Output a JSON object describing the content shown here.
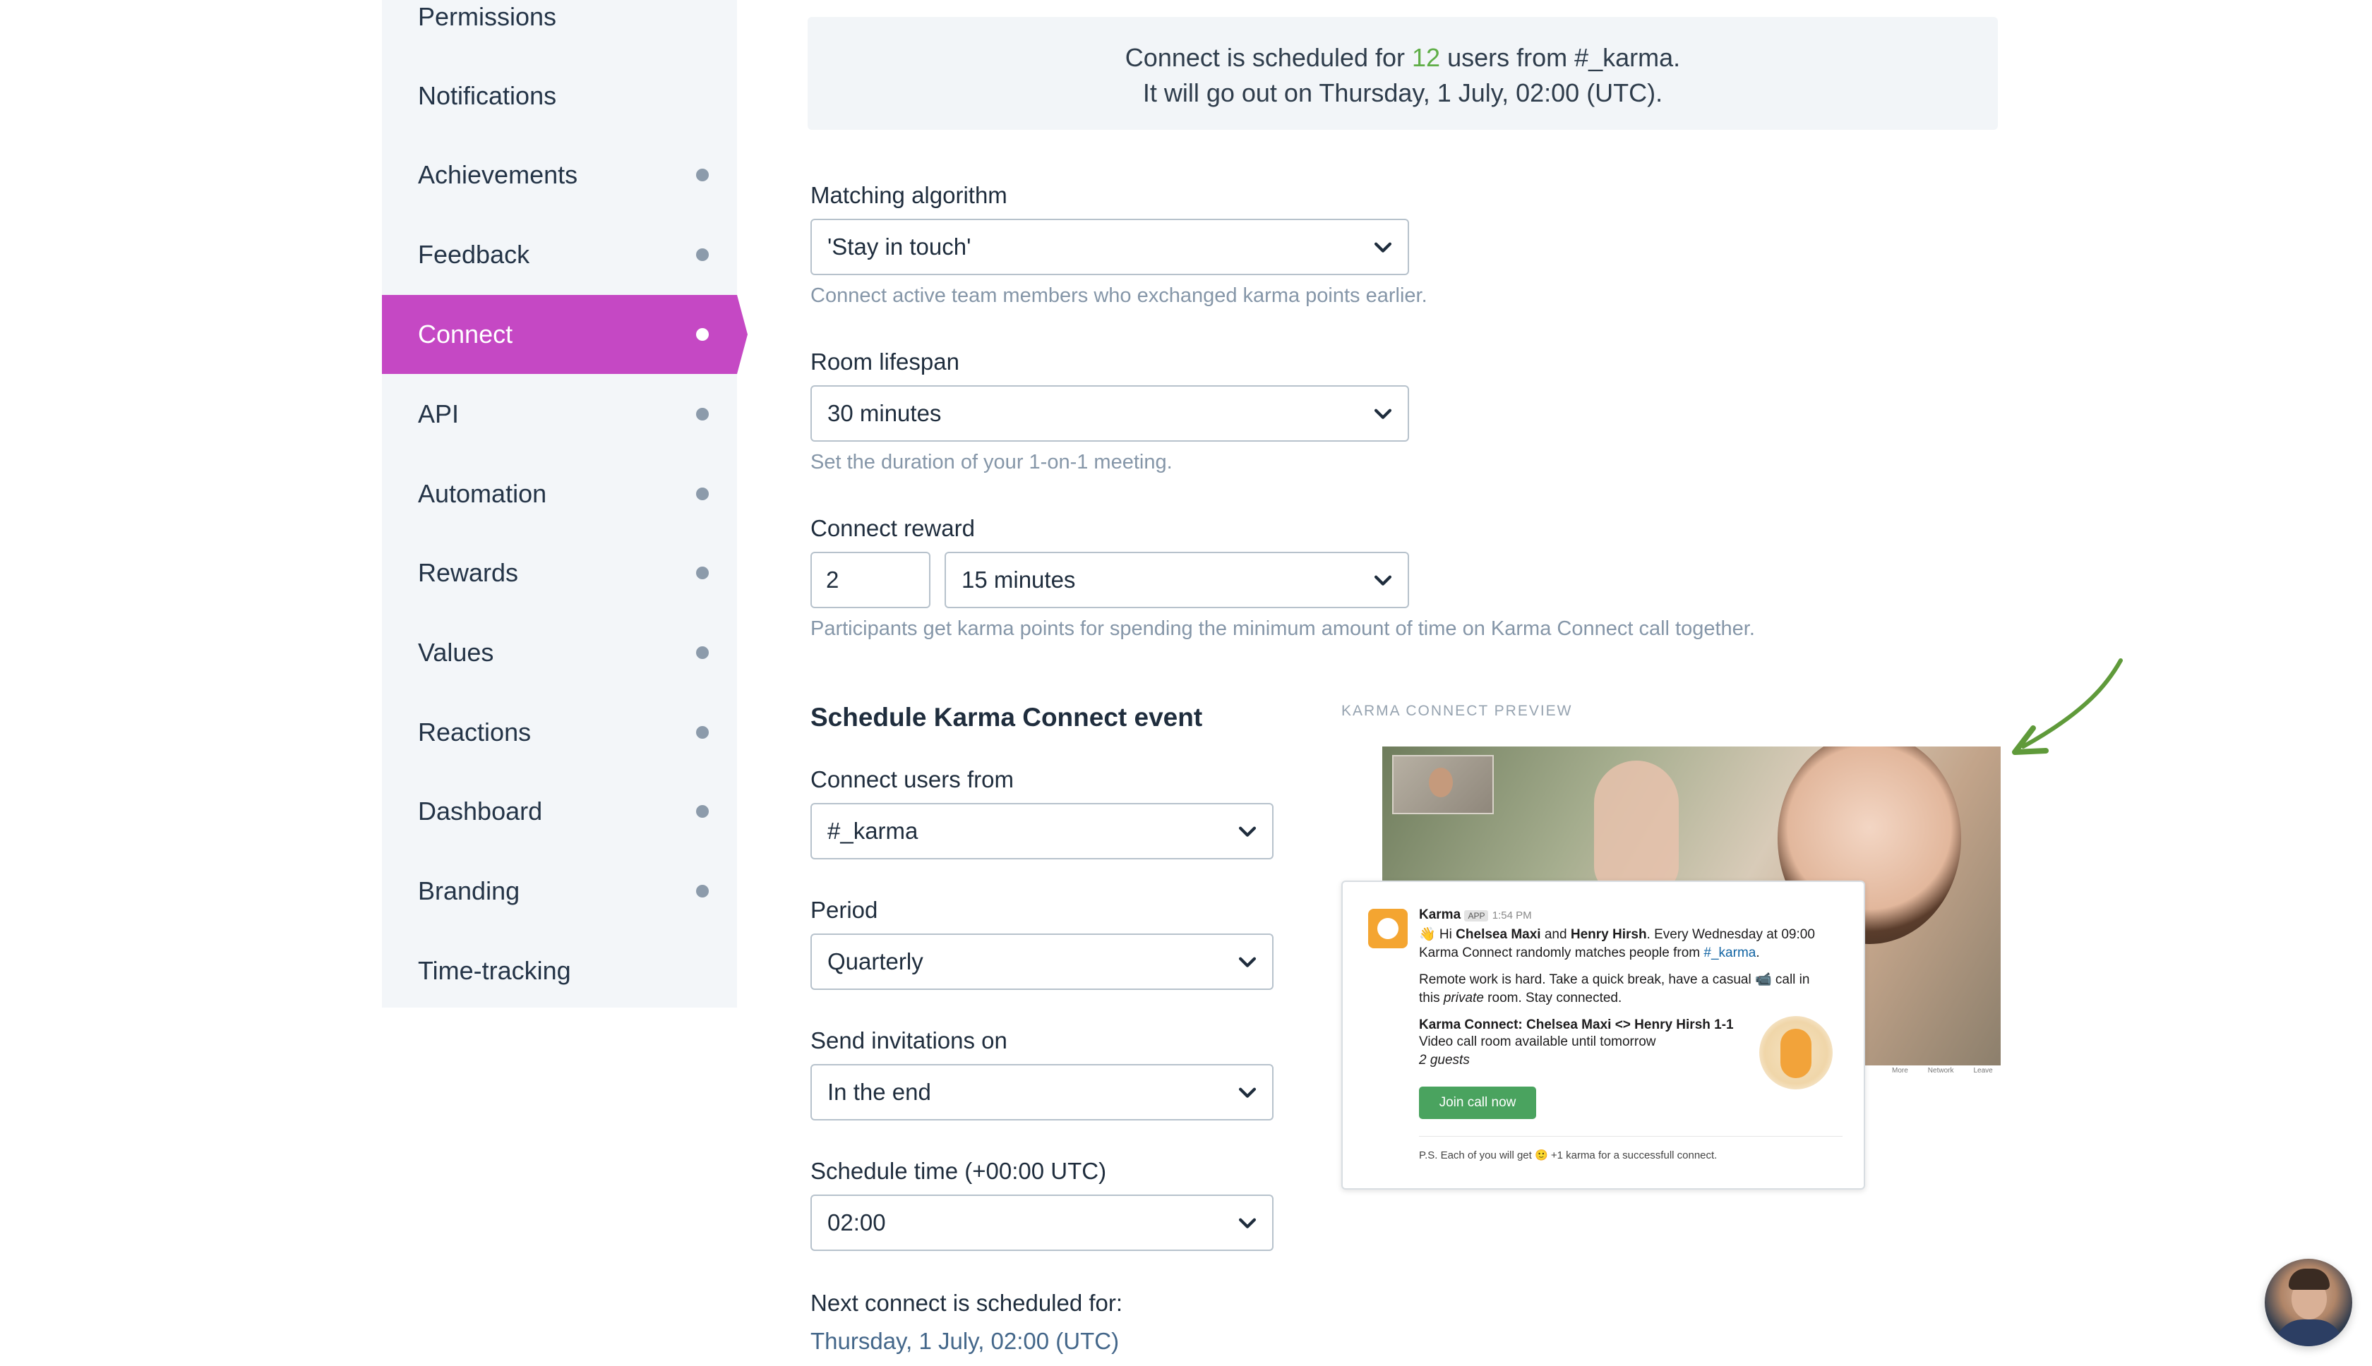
{
  "sidebar": {
    "items": [
      {
        "label": "Permissions",
        "dot": false,
        "active": false
      },
      {
        "label": "Notifications",
        "dot": false,
        "active": false
      },
      {
        "label": "Achievements",
        "dot": true,
        "active": false
      },
      {
        "label": "Feedback",
        "dot": true,
        "active": false
      },
      {
        "label": "Connect",
        "dot": true,
        "active": true
      },
      {
        "label": "API",
        "dot": true,
        "active": false
      },
      {
        "label": "Automation",
        "dot": true,
        "active": false
      },
      {
        "label": "Rewards",
        "dot": true,
        "active": false
      },
      {
        "label": "Values",
        "dot": true,
        "active": false
      },
      {
        "label": "Reactions",
        "dot": true,
        "active": false
      },
      {
        "label": "Dashboard",
        "dot": true,
        "active": false
      },
      {
        "label": "Branding",
        "dot": true,
        "active": false
      },
      {
        "label": "Time-tracking",
        "dot": false,
        "active": false
      }
    ]
  },
  "banner": {
    "pre": "Connect is scheduled for ",
    "count": "12",
    "post": " users from #_karma.",
    "line2": "It will go out on Thursday, 1 July, 02:00 (UTC)."
  },
  "matching": {
    "label": "Matching algorithm",
    "value": "'Stay in touch'",
    "help": "Connect active team members who exchanged karma points earlier."
  },
  "lifespan": {
    "label": "Room lifespan",
    "value": "30 minutes",
    "help": "Set the duration of your 1-on-1 meeting."
  },
  "reward": {
    "label": "Connect reward",
    "points": "2",
    "duration": "15 minutes",
    "help": "Participants get karma points for spending the minimum amount of time on Karma Connect call together."
  },
  "schedule": {
    "heading": "Schedule Karma Connect event",
    "users_label": "Connect users from",
    "users_value": "#_karma",
    "period_label": "Period",
    "period_value": "Quarterly",
    "invite_label": "Send invitations on",
    "invite_value": "In the end",
    "time_label": "Schedule time (+00:00 UTC)",
    "time_value": "02:00",
    "next_label": "Next connect is scheduled for:",
    "next_value": "Thursday, 1 July, 02:00 (UTC)"
  },
  "preview": {
    "label": "KARMA CONNECT PREVIEW",
    "bot_name": "Karma",
    "app_badge": "APP",
    "time": "1:54 PM",
    "line1_a": "👋 Hi ",
    "name1": "Chelsea Maxi",
    "line1_b": " and ",
    "name2": "Henry Hirsh",
    "line1_c": ". Every Wednesday at 09:00",
    "line2_a": "Karma Connect randomly matches people from ",
    "channel": "#_karma",
    "line2_b": ".",
    "line3": "Remote work is hard. Take a quick break, have a casual 📹 call in",
    "line4_a": "this ",
    "line4_em": "private",
    "line4_b": " room. Stay connected.",
    "room_title": "Karma Connect: Chelsea Maxi <> Henry Hirsh 1-1",
    "room_sub": "Video call room available until tomorrow",
    "guests": "2 guests",
    "join": "Join call now",
    "ps": "P.S. Each of you will get 🙂 +1 karma for a successfull connect.",
    "controls": [
      "More",
      "Network",
      "Leave"
    ]
  },
  "colors": {
    "accent": "#c548c4",
    "count_green": "#5fae47",
    "next_date": "#44678a",
    "arrow": "#5f9a3a"
  }
}
